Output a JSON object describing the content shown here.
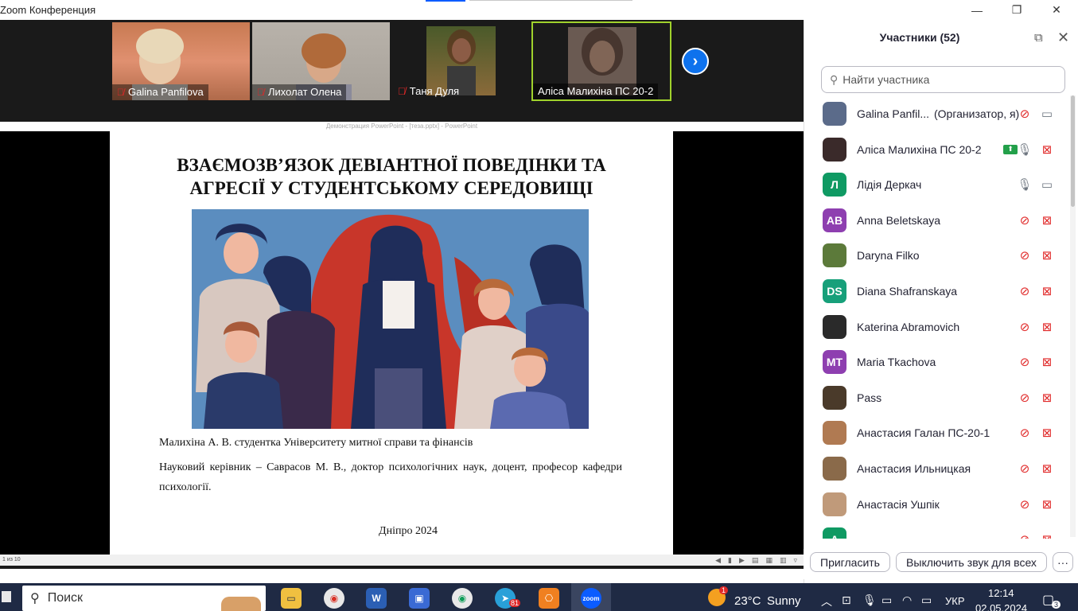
{
  "window": {
    "title": "Zoom Конференция",
    "minimize_glyph": "—",
    "maximize_glyph": "❐",
    "close_glyph": "✕"
  },
  "video_strip": {
    "participants": [
      {
        "name": "Galina Panfilova"
      },
      {
        "name": "Лихолат Олена"
      },
      {
        "name": "Таня Дуля"
      },
      {
        "name": "Аліса Малихіна ПС 20-2"
      }
    ],
    "next_glyph": "›"
  },
  "powerpoint": {
    "window_title": "Демонстрация PowerPoint - [теза.pptx] - PowerPoint",
    "slide_status": "1 из 10"
  },
  "slide": {
    "title_line1": "ВЗАЄМОЗВ’ЯЗОК ДЕВІАНТНОЇ ПОВЕДІНКИ ТА",
    "title_line2": "АГРЕСІЇ У СТУДЕНТСЬКОМУ СЕРЕДОВИЩІ",
    "author": "Малихіна А. В. студентка Університету митної справи та фінансів",
    "advisor": "Науковий керівник – Саврасов М. В., доктор психологічних наук, доцент, професор кафедри психології.",
    "city_year": "Дніпро 2024"
  },
  "participants_panel": {
    "title": "Участники (52)",
    "search_placeholder": "Найти участника",
    "items": [
      {
        "name": "Galina Panfil...",
        "role": "(Организатор, я)",
        "avatar_text": "",
        "avatar_color": "#5b6b8a"
      },
      {
        "name": "Аліса Малихіна ПС 20-2",
        "role": "",
        "avatar_text": "",
        "avatar_color": "#3a2a2a"
      },
      {
        "name": "Лідія Деркач",
        "role": "",
        "avatar_text": "Л",
        "avatar_color": "#0f9a63"
      },
      {
        "name": "Anna Beletskaya",
        "role": "",
        "avatar_text": "AB",
        "avatar_color": "#8e3fb0"
      },
      {
        "name": "Daryna Filko",
        "role": "",
        "avatar_text": "",
        "avatar_color": "#5c7a3a"
      },
      {
        "name": "Diana Shafranskaya",
        "role": "",
        "avatar_text": "DS",
        "avatar_color": "#17a07a"
      },
      {
        "name": "Katerina Abramovich",
        "role": "",
        "avatar_text": "",
        "avatar_color": "#2a2a2a"
      },
      {
        "name": "Maria Tkachova",
        "role": "",
        "avatar_text": "MT",
        "avatar_color": "#8e3fb0"
      },
      {
        "name": "Pass",
        "role": "",
        "avatar_text": "",
        "avatar_color": "#4a3a2a"
      },
      {
        "name": "Анастасия Галан ПС-20-1",
        "role": "",
        "avatar_text": "",
        "avatar_color": "#b07a52"
      },
      {
        "name": "Анастасия Ильницкая",
        "role": "",
        "avatar_text": "",
        "avatar_color": "#8a6a4a"
      },
      {
        "name": "Анастасія Ушпік",
        "role": "",
        "avatar_text": "",
        "avatar_color": "#c09a7a"
      },
      {
        "name": "",
        "role": "",
        "avatar_text": "А",
        "avatar_color": "#0f9a63"
      }
    ],
    "invite_label": "Пригласить",
    "mute_all_label": "Выключить звук для всех",
    "more_glyph": "···"
  },
  "taskbar": {
    "search_label": "Поиск",
    "weather_temp": "23°C",
    "weather_desc": "Sunny",
    "weather_badge": "1",
    "language": "УКР",
    "time": "12:14",
    "date": "02.05.2024",
    "notification_count": "3",
    "telegram_badge": "81"
  }
}
